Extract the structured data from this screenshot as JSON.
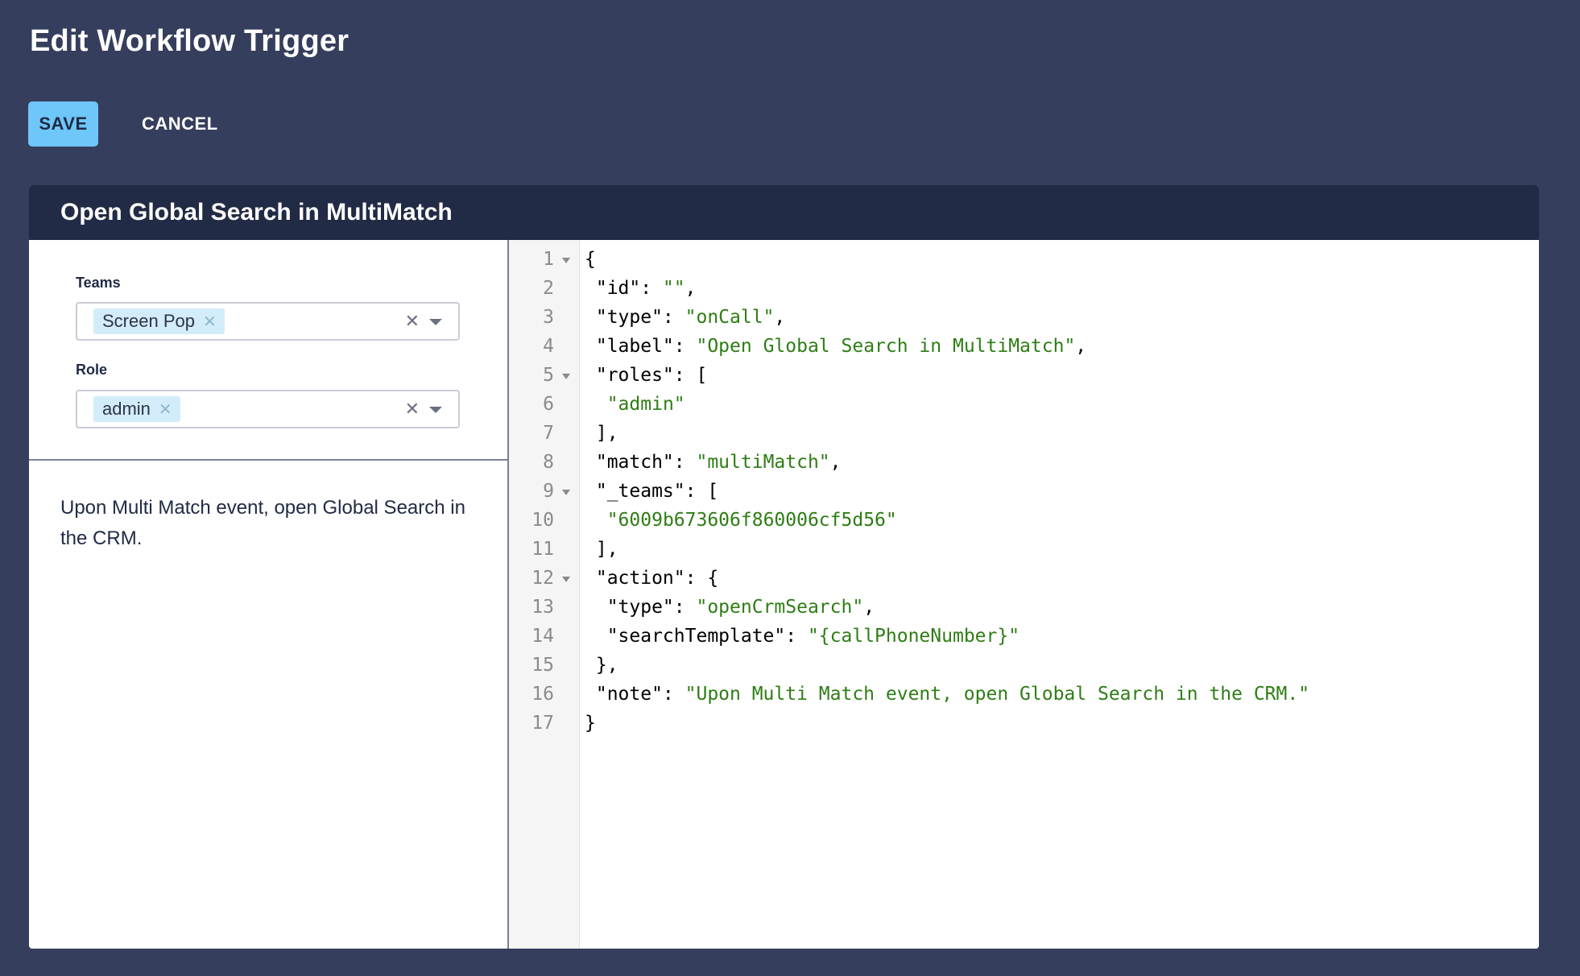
{
  "page": {
    "title": "Edit Workflow Trigger"
  },
  "toolbar": {
    "save_label": "SAVE",
    "cancel_label": "CANCEL"
  },
  "card": {
    "title": "Open Global Search in MultiMatch",
    "teams": {
      "label": "Teams",
      "chips": [
        "Screen Pop"
      ]
    },
    "role": {
      "label": "Role",
      "chips": [
        "admin"
      ]
    },
    "description": "Upon Multi Match event, open Global Search in the CRM."
  },
  "editor": {
    "fold_lines": [
      1,
      5,
      9,
      12
    ],
    "lines": [
      [
        {
          "t": "{"
        }
      ],
      [
        {
          "t": " \"id\": "
        },
        {
          "t": "\"\"",
          "s": 1
        },
        {
          "t": ","
        }
      ],
      [
        {
          "t": " \"type\": "
        },
        {
          "t": "\"onCall\"",
          "s": 1
        },
        {
          "t": ","
        }
      ],
      [
        {
          "t": " \"label\": "
        },
        {
          "t": "\"Open Global Search in MultiMatch\"",
          "s": 1
        },
        {
          "t": ","
        }
      ],
      [
        {
          "t": " \"roles\": ["
        }
      ],
      [
        {
          "t": "  "
        },
        {
          "t": "\"admin\"",
          "s": 1
        }
      ],
      [
        {
          "t": " ],"
        }
      ],
      [
        {
          "t": " \"match\": "
        },
        {
          "t": "\"multiMatch\"",
          "s": 1
        },
        {
          "t": ","
        }
      ],
      [
        {
          "t": " \"_teams\": ["
        }
      ],
      [
        {
          "t": "  "
        },
        {
          "t": "\"6009b673606f860006cf5d56\"",
          "s": 1
        }
      ],
      [
        {
          "t": " ],"
        }
      ],
      [
        {
          "t": " \"action\": {"
        }
      ],
      [
        {
          "t": "  \"type\": "
        },
        {
          "t": "\"openCrmSearch\"",
          "s": 1
        },
        {
          "t": ","
        }
      ],
      [
        {
          "t": "  \"searchTemplate\": "
        },
        {
          "t": "\"{callPhoneNumber}\"",
          "s": 1
        }
      ],
      [
        {
          "t": " },"
        }
      ],
      [
        {
          "t": " \"note\": "
        },
        {
          "t": "\"Upon Multi Match event, open Global Search in the CRM.\"",
          "s": 1
        }
      ],
      [
        {
          "t": "}"
        }
      ]
    ]
  },
  "colors": {
    "background": "#353e5c",
    "header": "#222b45",
    "accent": "#6ec6f9",
    "string": "#2e7d14"
  }
}
